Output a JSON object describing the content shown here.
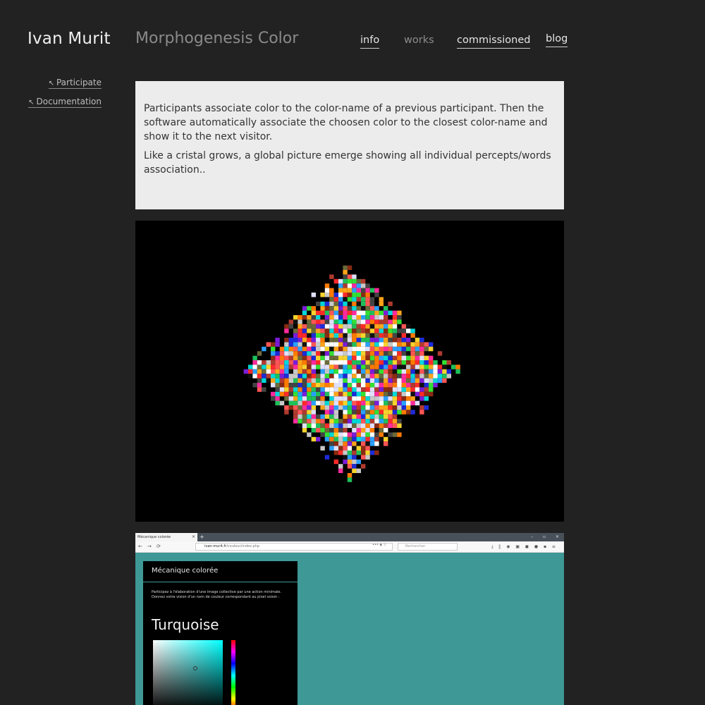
{
  "header": {
    "site_name": "Ivan Murit",
    "page_title": "Morphogenesis Color",
    "nav": [
      {
        "label": "info",
        "active": true
      },
      {
        "label": "works",
        "active": false
      },
      {
        "label": "commissioned",
        "active": true
      },
      {
        "label": "blog",
        "active": true
      }
    ]
  },
  "sidebar": {
    "links": [
      {
        "label": "Participate",
        "icon": "arrow-up-left-icon"
      },
      {
        "label": "Documentation",
        "icon": "arrow-up-left-icon"
      }
    ],
    "arrow_glyph": "↖"
  },
  "description": {
    "paragraphs": [
      "Participants associate color to the color-name of a previous participant. Then the software automatically associate the choosen color to the closest color-name and show it to the next visitor.",
      "Like a cristal grows, a global picture emerge showing all individual percepts/words association.."
    ]
  },
  "artwork": {
    "description_icon": "pixel-diamond-image",
    "palette": [
      "#ff2a2a",
      "#ff7a00",
      "#ffa41a",
      "#f6d32d",
      "#33e033",
      "#1fbf5a",
      "#2aa0ff",
      "#1c2bd8",
      "#7a1cd8",
      "#ff2a9d",
      "#ffffff",
      "#c8c8c8",
      "#8a2a12",
      "#444444",
      "#00d8d8",
      "#ff5555",
      "#b03a2e",
      "#e0e0ff",
      "#6a6a3a",
      "#111111"
    ]
  },
  "screenshot": {
    "tab_title": "Mécanique colorée",
    "tab_close": "×",
    "new_tab": "+",
    "window_controls": [
      "–",
      "▫",
      "✕"
    ],
    "nav_buttons": [
      "←",
      "→",
      "⟳"
    ],
    "url_host": "ivan-murit.fr",
    "url_path": "/couleur/index.php",
    "url_icons": "••• ◈ ☆",
    "search_placeholder": "Rechercher",
    "toolbar_icons": "⤓ ⫼ ◉ ▣ ◼ ● ▪ ≡",
    "panel": {
      "title": "Mécanique colorée",
      "intro": "Participez à l'élaboration d'une image collective par une action minimale. Donnez votre vision d'un nom de couleur correspondant au pixel voisin :",
      "color_name": "Turquoise"
    },
    "background_color": "#3e9896"
  }
}
